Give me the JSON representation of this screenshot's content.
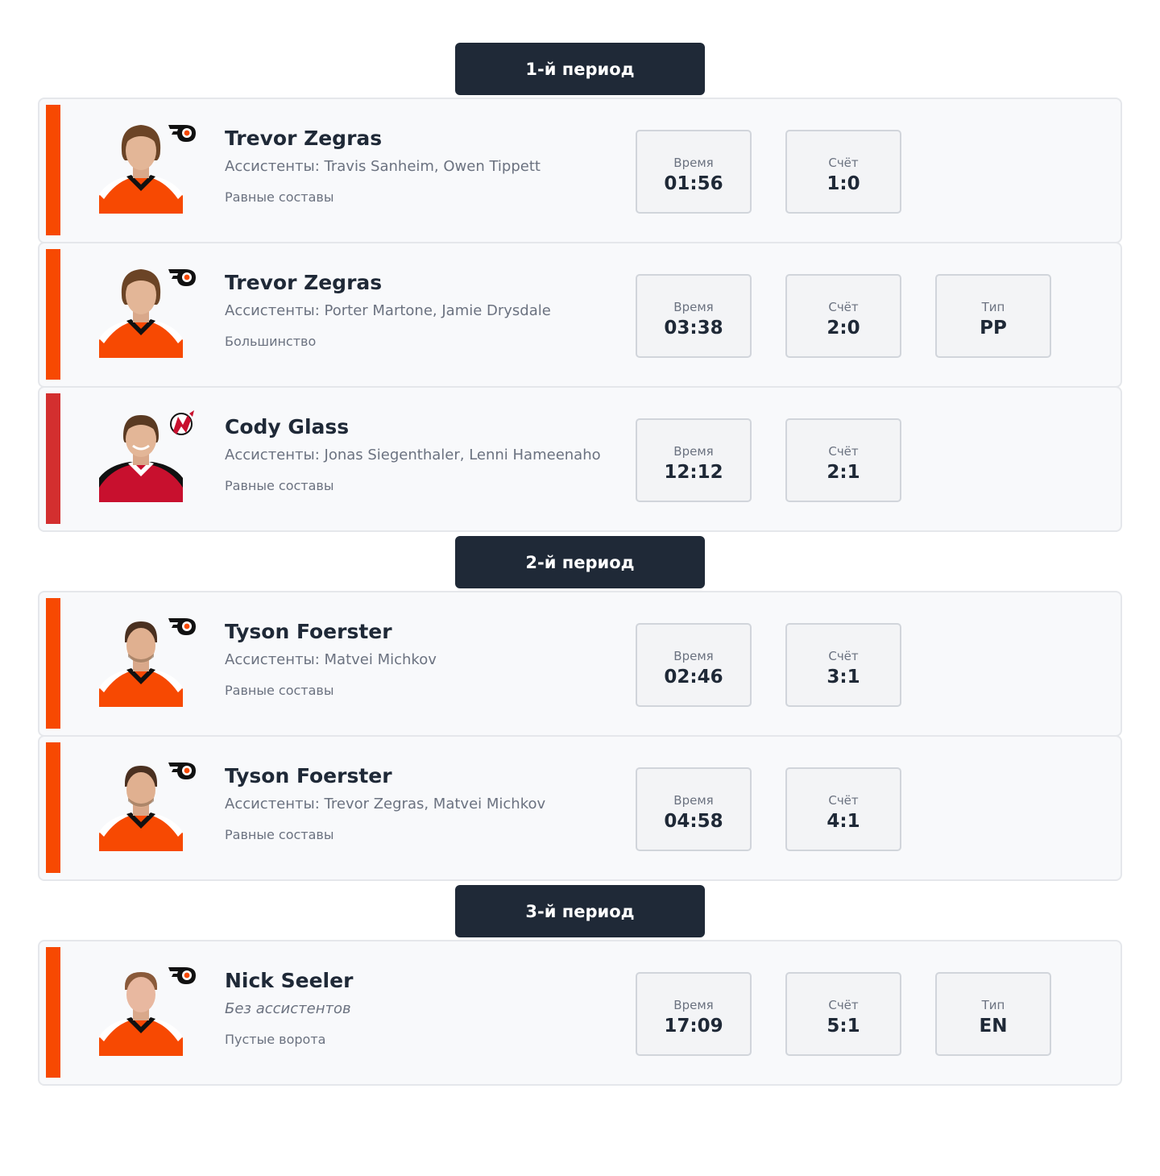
{
  "colors": {
    "flyers": "#f74902",
    "devils": "#d32f2f",
    "header_bg": "#1f2937"
  },
  "labels": {
    "time": "Время",
    "score": "Счёт",
    "type": "Тип"
  },
  "periods": [
    {
      "title": "1-й период",
      "goals": [
        {
          "team": "flyers",
          "team_logo": "flyers-logo-icon",
          "scorer": "Trevor Zegras",
          "assists": "Ассистенты: Travis Sanheim, Owen Tippett",
          "strength": "Равные составы",
          "time": "01:56",
          "score": "1:0",
          "type": null
        },
        {
          "team": "flyers",
          "team_logo": "flyers-logo-icon",
          "scorer": "Trevor Zegras",
          "assists": "Ассистенты: Porter Martone, Jamie Drysdale",
          "strength": "Большинство",
          "time": "03:38",
          "score": "2:0",
          "type": "PP"
        },
        {
          "team": "devils",
          "team_logo": "devils-logo-icon",
          "scorer": "Cody Glass",
          "assists": "Ассистенты: Jonas Siegenthaler, Lenni Hameenaho",
          "strength": "Равные составы",
          "time": "12:12",
          "score": "2:1",
          "type": null
        }
      ]
    },
    {
      "title": "2-й период",
      "goals": [
        {
          "team": "flyers",
          "team_logo": "flyers-logo-icon",
          "scorer": "Tyson Foerster",
          "assists": "Ассистенты: Matvei Michkov",
          "strength": "Равные составы",
          "time": "02:46",
          "score": "3:1",
          "type": null
        },
        {
          "team": "flyers",
          "team_logo": "flyers-logo-icon",
          "scorer": "Tyson Foerster",
          "assists": "Ассистенты: Trevor Zegras, Matvei Michkov",
          "strength": "Равные составы",
          "time": "04:58",
          "score": "4:1",
          "type": null
        }
      ]
    },
    {
      "title": "3-й период",
      "goals": [
        {
          "team": "flyers",
          "team_logo": "flyers-logo-icon",
          "scorer": "Nick Seeler",
          "assists": "Без ассистентов",
          "assists_none": true,
          "strength": "Пустые ворота",
          "time": "17:09",
          "score": "5:1",
          "type": "EN"
        }
      ]
    }
  ]
}
